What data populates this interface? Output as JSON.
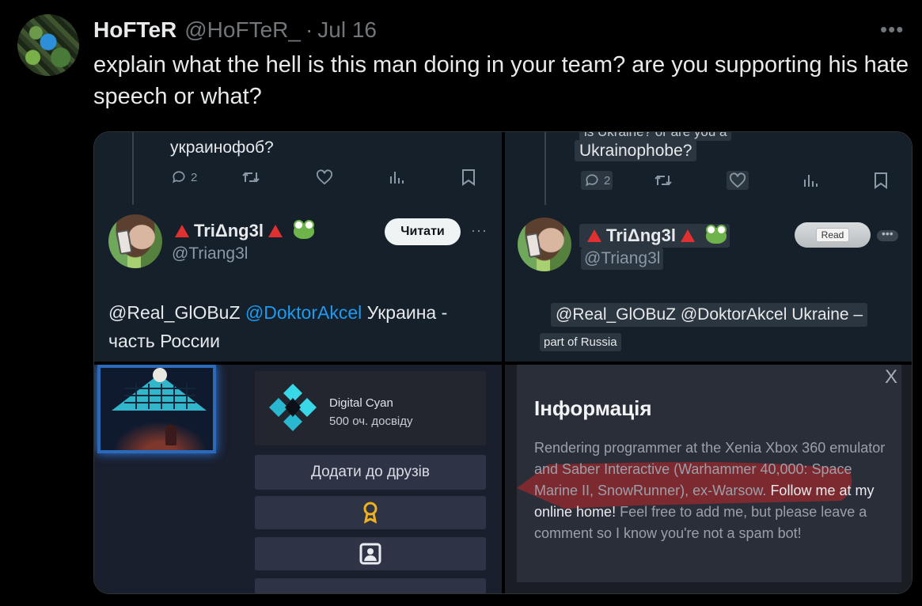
{
  "tweet": {
    "author_name": "HoFTeR",
    "author_handle": "@HoFTeR_",
    "separator": "·",
    "date": "Jul 16",
    "more_label": "•••",
    "text": "explain what the hell is this man doing in your team? are you supporting his hate speech or what?"
  },
  "screenshot_left": {
    "prev_text": "украинофоб?",
    "reply_count": "2",
    "user_name": "TriΔng3l",
    "user_handle": "@Triang3l",
    "follow_label": "Читати",
    "more_label": "···",
    "mention_1": "@Real_GlOBuZ",
    "mention_2": "@DoktorAkcel",
    "body_rest": "Украина -",
    "body_line2": "часть России"
  },
  "screenshot_right": {
    "prev_cut": "is Ukraine? or are you a",
    "prev_text": "Ukrainophobe?",
    "reply_count": "2",
    "user_name": "TriΔng3l",
    "user_handle": "@Triang3l",
    "follow_label": "Read",
    "more_label": "•••",
    "body_line1": "@Real_GlOBuZ @DoktorAkcel Ukraine –",
    "body_line2": "part of Russia"
  },
  "steam_profile": {
    "badge_name": "Digital Cyan",
    "badge_xp": "500 оч. досвіду",
    "add_friend_label": "Додати до друзів"
  },
  "info_dialog": {
    "close_label": "X",
    "title": "Інформація",
    "text_part1": "Rendering programmer at the Xenia Xbox 360 emulator and Saber Interactive (Warhammer 40,000: Space Marine II, SnowRunner), ex-Warsow. ",
    "link_text": "Follow me at my online home!",
    "text_part2": " Feel free to add me, but please leave a comment so I know you're not a spam bot!"
  },
  "colors": {
    "background": "#000000",
    "twitter_dim": "#15202b",
    "mention_blue": "#1d9bf0",
    "steam_bg": "#1a1f2e",
    "annotation_red": "#c0282a"
  },
  "icons": [
    "reply-icon",
    "retweet-icon",
    "like-icon",
    "views-icon",
    "bookmark-icon",
    "award-icon",
    "portrait-icon",
    "close-icon"
  ]
}
